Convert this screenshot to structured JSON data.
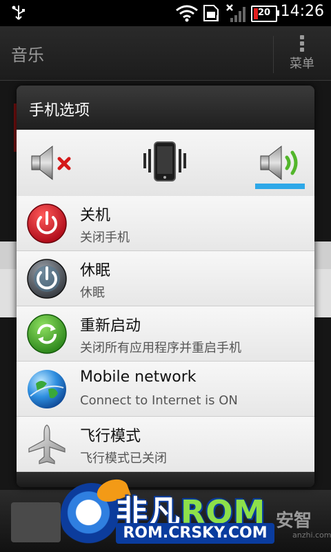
{
  "status_bar": {
    "time": "14:26",
    "battery_level": "20",
    "icons": [
      "usb-icon",
      "wifi-icon",
      "sim-icon",
      "no-signal-icon",
      "battery-icon"
    ]
  },
  "app": {
    "title": "音乐",
    "menu_label": "菜单"
  },
  "dialog": {
    "title": "手机选项",
    "sound_modes": [
      {
        "name": "mute",
        "icon": "mute-speaker-icon",
        "selected": false
      },
      {
        "name": "vibrate",
        "icon": "vibrate-phone-icon",
        "selected": false
      },
      {
        "name": "sound",
        "icon": "speaker-icon",
        "selected": true
      }
    ],
    "items": [
      {
        "title": "关机",
        "subtitle": "关闭手机",
        "icon": "power-off-icon"
      },
      {
        "title": "休眠",
        "subtitle": "休眠",
        "icon": "sleep-icon"
      },
      {
        "title": "重新启动",
        "subtitle": "关闭所有应用程序并重启手机",
        "icon": "restart-icon"
      },
      {
        "title": "Mobile network",
        "subtitle": "Connect to Internet is ON",
        "icon": "globe-network-icon"
      },
      {
        "title": "飞行模式",
        "subtitle": "飞行模式已关闭",
        "icon": "airplane-icon"
      }
    ]
  },
  "watermark": {
    "brand_cn": "非凡",
    "brand_en": "ROM",
    "url": "ROM.CRSKY.COM",
    "anzhi_cn": "安智",
    "anzhi_url": "anzhi.com"
  },
  "colors": {
    "accent": "#2ea8e8",
    "power_red": "#c8101e",
    "restart_green": "#3aa52a"
  }
}
